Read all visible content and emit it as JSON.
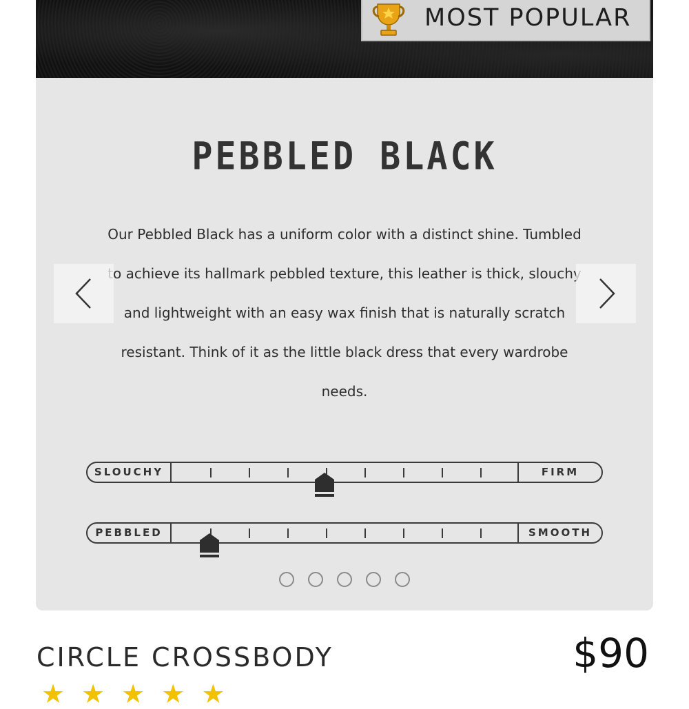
{
  "badge": {
    "label": "MOST POPULAR",
    "icon": "trophy-icon"
  },
  "card": {
    "title": "PEBBLED BLACK",
    "description": "Our Pebbled Black has a uniform color with a distinct shine. Tumbled to achieve its hallmark pebbled texture, this leather is thick, slouchy and lightweight with an easy wax finish that is naturally scratch resistant. Think of it as the little black dress that every wardrobe needs."
  },
  "sliders": [
    {
      "left_label": "SLOUCHY",
      "right_label": "FIRM",
      "level": 0.44
    },
    {
      "left_label": "PEBBLED",
      "right_label": "SMOOTH",
      "level": 0.11
    }
  ],
  "carousel": {
    "pages": 5
  },
  "product": {
    "name": "CIRCLE CROSSBODY",
    "price": "$90",
    "rating": 5
  },
  "colors": {
    "accent_gold": "#f2c200",
    "card_bg": "#e6e6e6"
  }
}
